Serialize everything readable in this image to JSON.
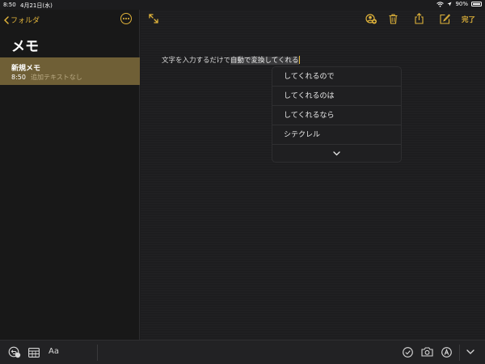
{
  "status": {
    "time": "8:50",
    "date": "4月21日(水)",
    "battery": "90%",
    "battery_level": 0.9
  },
  "sidebar": {
    "back_label": "フォルダ",
    "title": "メモ",
    "notes": [
      {
        "title": "新規メモ",
        "time": "8:50",
        "preview": "追加テキストなし"
      }
    ]
  },
  "toolbar": {
    "done_label": "完了"
  },
  "editor": {
    "text_plain": "文字を入力するだけで",
    "text_marked": "自動で変換してくれる"
  },
  "candidates": [
    "してくれるので",
    "してくれるのは",
    "してくれるなら",
    "シテクレル"
  ],
  "bottom": {
    "format_label": "Aa"
  },
  "colors": {
    "accent": "#e0b33a",
    "selected_note": "#6f5f36",
    "background": "#1d1d1f"
  }
}
